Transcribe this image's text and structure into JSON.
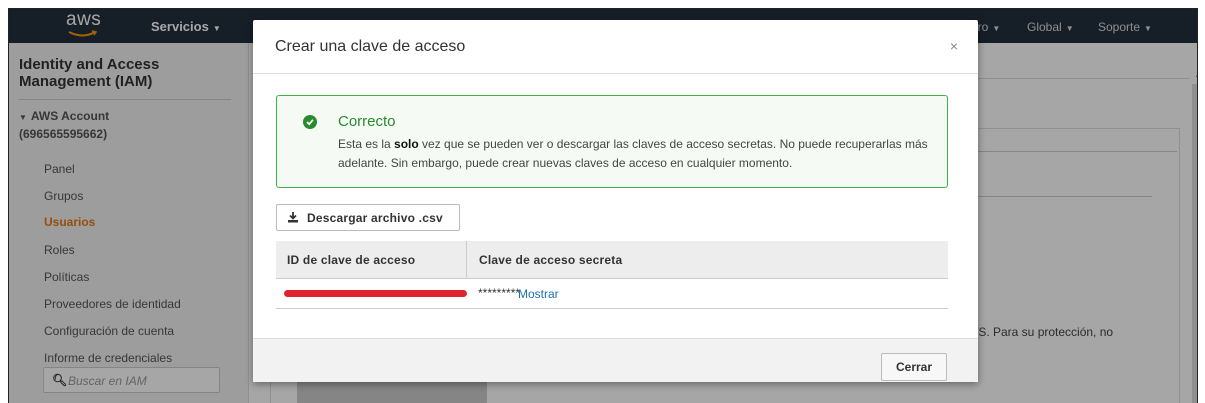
{
  "topnav": {
    "logo_text": "aws",
    "services_label": "Servicios",
    "user_label": "oro",
    "region_label": "Global",
    "support_label": "Soporte"
  },
  "sidebar": {
    "title": "Identity and Access Management (IAM)",
    "account_line1": "AWS Account",
    "account_line2": "(696565595662)",
    "items": [
      {
        "label": "Panel",
        "active": false
      },
      {
        "label": "Grupos",
        "active": false
      },
      {
        "label": "Usuarios",
        "active": true
      },
      {
        "label": "Roles",
        "active": false
      },
      {
        "label": "Políticas",
        "active": false
      },
      {
        "label": "Proveedores de identidad",
        "active": false
      },
      {
        "label": "Configuración de cuenta",
        "active": false
      },
      {
        "label": "Informe de credenciales",
        "active": false
      }
    ],
    "search_placeholder": "Buscar en IAM"
  },
  "background": {
    "partial_text": "WS. Para su protección, no"
  },
  "modal": {
    "title": "Crear una clave de acceso",
    "close_symbol": "×",
    "alert": {
      "title": "Correcto",
      "msg_before": "Esta es la ",
      "msg_bold": "solo",
      "msg_after": " vez que se pueden ver o descargar las claves de acceso secretas. No puede recuperarlas más adelante. Sin embargo, puede crear nuevas claves de acceso en cualquier momento.",
      "color": "#2a8b2e"
    },
    "download_button": "Descargar archivo .csv",
    "table": {
      "headers": [
        "ID de clave de acceso",
        "Clave de acceso secreta"
      ],
      "secret_masked": "*********",
      "show_link": "Mostrar"
    },
    "close_button": "Cerrar"
  },
  "colors": {
    "nav_bg": "#232f3e",
    "active_item": "#e47911",
    "link": "#1a6fb8",
    "success_border": "#3ab44a"
  }
}
